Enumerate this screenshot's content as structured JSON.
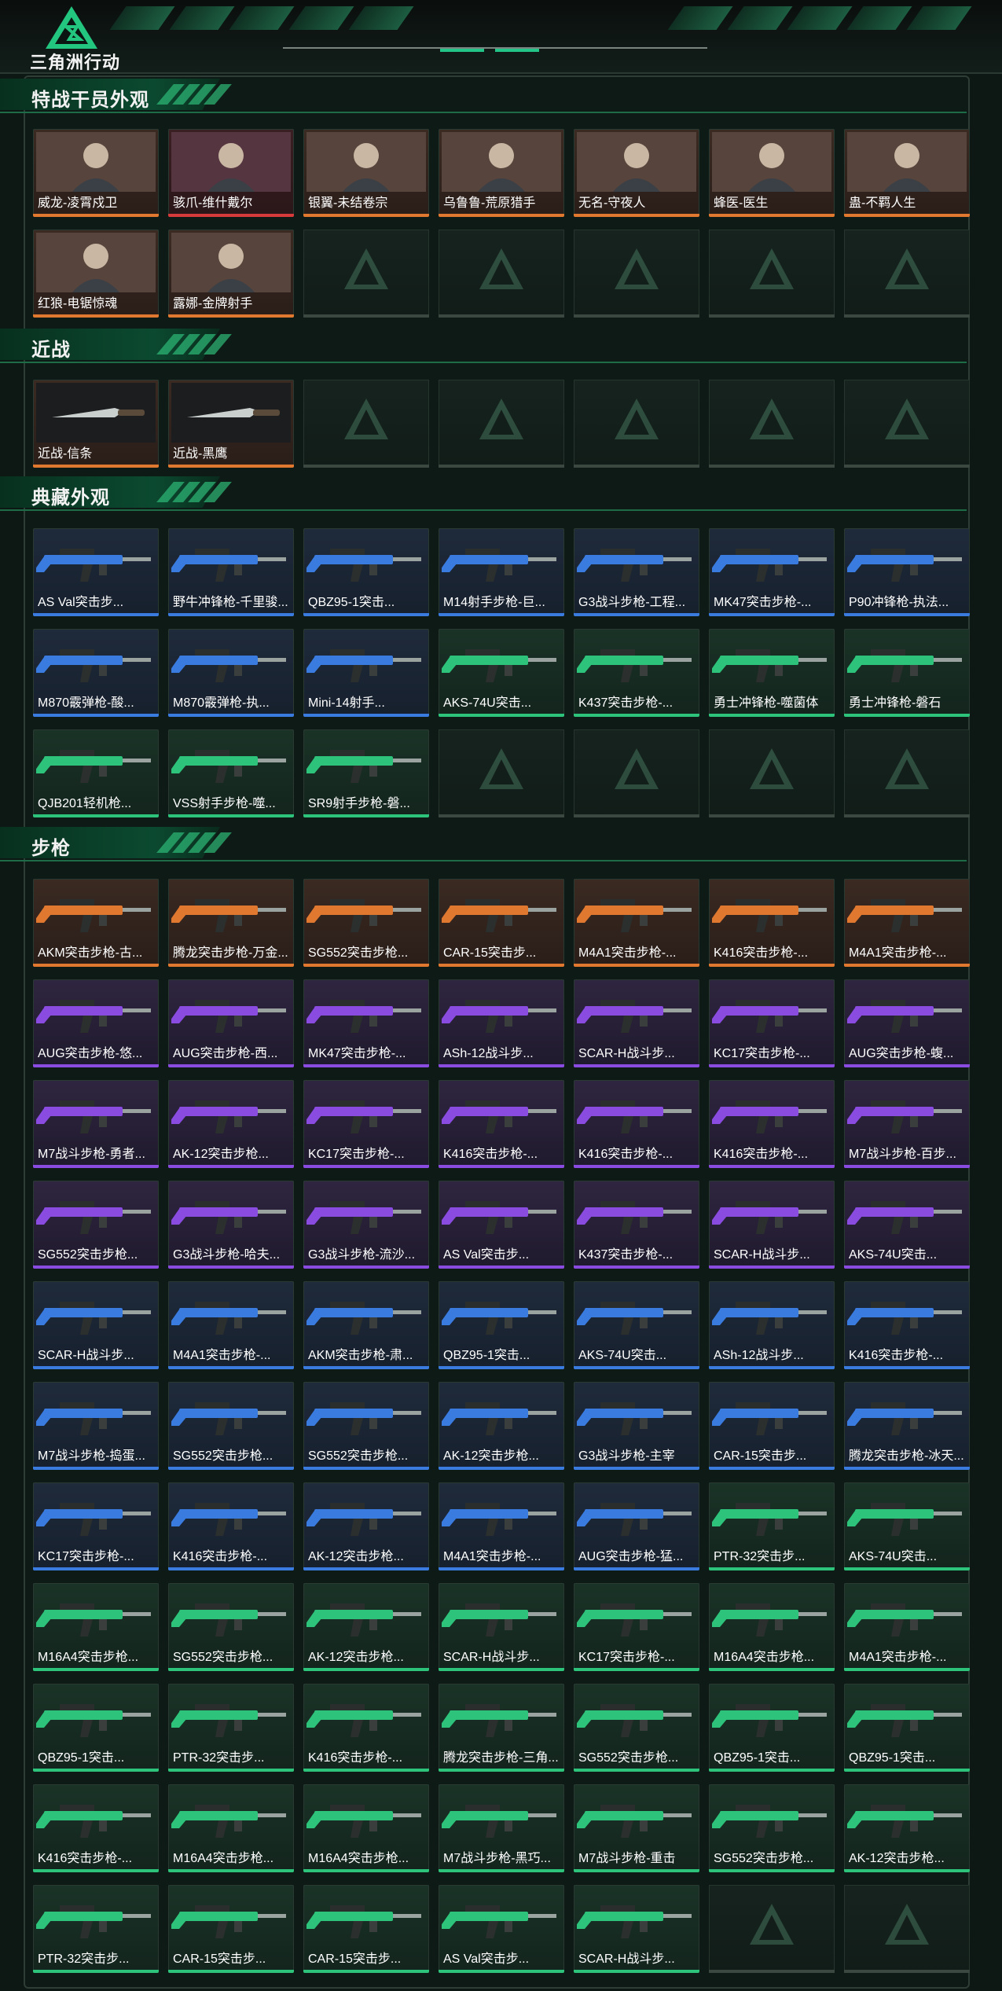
{
  "app_title": "三角洲行动",
  "sections": [
    {
      "id": "operators",
      "title": "特战干员外观",
      "empty_slots": 5,
      "items": [
        {
          "label": "威龙-凌霄戍卫",
          "rarity": "orange",
          "icon": "operator-portrait"
        },
        {
          "label": "骇爪-维什戴尔",
          "rarity": "red",
          "icon": "operator-portrait"
        },
        {
          "label": "银翼-未结卷宗",
          "rarity": "orange",
          "icon": "operator-portrait"
        },
        {
          "label": "乌鲁鲁-荒原猎手",
          "rarity": "orange",
          "icon": "operator-portrait"
        },
        {
          "label": "无名-守夜人",
          "rarity": "orange",
          "icon": "operator-portrait"
        },
        {
          "label": "蜂医-医生",
          "rarity": "orange",
          "icon": "operator-portrait"
        },
        {
          "label": "蛊-不羁人生",
          "rarity": "orange",
          "icon": "operator-portrait"
        },
        {
          "label": "红狼-电锯惊魂",
          "rarity": "orange",
          "icon": "operator-portrait"
        },
        {
          "label": "露娜-金牌射手",
          "rarity": "orange",
          "icon": "operator-portrait"
        }
      ]
    },
    {
      "id": "melee",
      "title": "近战",
      "empty_slots": 5,
      "items": [
        {
          "label": "近战-信条",
          "rarity": "orange",
          "icon": "knife"
        },
        {
          "label": "近战-黑鹰",
          "rarity": "orange",
          "icon": "knife"
        }
      ]
    },
    {
      "id": "collection",
      "title": "典藏外观",
      "empty_slots": 4,
      "items": [
        {
          "label": "AS Val突击步...",
          "rarity": "blue",
          "icon": "rifle"
        },
        {
          "label": "野牛冲锋枪-千里骏...",
          "rarity": "blue",
          "icon": "rifle"
        },
        {
          "label": "QBZ95-1突击...",
          "rarity": "blue",
          "icon": "rifle"
        },
        {
          "label": "M14射手步枪-巨...",
          "rarity": "blue",
          "icon": "rifle"
        },
        {
          "label": "G3战斗步枪-工程...",
          "rarity": "blue",
          "icon": "rifle"
        },
        {
          "label": "MK47突击步枪-...",
          "rarity": "blue",
          "icon": "rifle"
        },
        {
          "label": "P90冲锋枪-执法...",
          "rarity": "blue",
          "icon": "rifle"
        },
        {
          "label": "M870霰弹枪-酸...",
          "rarity": "blue",
          "icon": "rifle"
        },
        {
          "label": "M870霰弹枪-执...",
          "rarity": "blue",
          "icon": "rifle"
        },
        {
          "label": "Mini-14射手...",
          "rarity": "blue",
          "icon": "rifle"
        },
        {
          "label": "AKS-74U突击...",
          "rarity": "green",
          "icon": "rifle"
        },
        {
          "label": "K437突击步枪-...",
          "rarity": "green",
          "icon": "rifle"
        },
        {
          "label": "勇士冲锋枪-噬菌体",
          "rarity": "green",
          "icon": "rifle"
        },
        {
          "label": "勇士冲锋枪-磐石",
          "rarity": "green",
          "icon": "rifle"
        },
        {
          "label": "QJB201轻机枪...",
          "rarity": "green",
          "icon": "rifle"
        },
        {
          "label": "VSS射手步枪-噬...",
          "rarity": "green",
          "icon": "rifle"
        },
        {
          "label": "SR9射手步枪-磐...",
          "rarity": "green",
          "icon": "rifle"
        }
      ]
    },
    {
      "id": "rifles",
      "title": "步枪",
      "empty_slots": 2,
      "items": [
        {
          "label": "AKM突击步枪-古...",
          "rarity": "orange",
          "icon": "rifle"
        },
        {
          "label": "腾龙突击步枪-万金...",
          "rarity": "orange",
          "icon": "rifle"
        },
        {
          "label": "SG552突击步枪...",
          "rarity": "orange",
          "icon": "rifle"
        },
        {
          "label": "CAR-15突击步...",
          "rarity": "orange",
          "icon": "rifle"
        },
        {
          "label": "M4A1突击步枪-...",
          "rarity": "orange",
          "icon": "rifle"
        },
        {
          "label": "K416突击步枪-...",
          "rarity": "orange",
          "icon": "rifle"
        },
        {
          "label": "M4A1突击步枪-...",
          "rarity": "orange",
          "icon": "rifle"
        },
        {
          "label": "AUG突击步枪-悠...",
          "rarity": "purple",
          "icon": "rifle"
        },
        {
          "label": "AUG突击步枪-西...",
          "rarity": "purple",
          "icon": "rifle"
        },
        {
          "label": "MK47突击步枪-...",
          "rarity": "purple",
          "icon": "rifle"
        },
        {
          "label": "ASh-12战斗步...",
          "rarity": "purple",
          "icon": "rifle"
        },
        {
          "label": "SCAR-H战斗步...",
          "rarity": "purple",
          "icon": "rifle"
        },
        {
          "label": "KC17突击步枪-...",
          "rarity": "purple",
          "icon": "rifle"
        },
        {
          "label": "AUG突击步枪-蝮...",
          "rarity": "purple",
          "icon": "rifle"
        },
        {
          "label": "M7战斗步枪-勇者...",
          "rarity": "purple",
          "icon": "rifle"
        },
        {
          "label": "AK-12突击步枪...",
          "rarity": "purple",
          "icon": "rifle"
        },
        {
          "label": "KC17突击步枪-...",
          "rarity": "purple",
          "icon": "rifle"
        },
        {
          "label": "K416突击步枪-...",
          "rarity": "purple",
          "icon": "rifle"
        },
        {
          "label": "K416突击步枪-...",
          "rarity": "purple",
          "icon": "rifle"
        },
        {
          "label": "K416突击步枪-...",
          "rarity": "purple",
          "icon": "rifle"
        },
        {
          "label": "M7战斗步枪-百步...",
          "rarity": "purple",
          "icon": "rifle"
        },
        {
          "label": "SG552突击步枪...",
          "rarity": "purple",
          "icon": "rifle"
        },
        {
          "label": "G3战斗步枪-哈夫...",
          "rarity": "purple",
          "icon": "rifle"
        },
        {
          "label": "G3战斗步枪-流沙...",
          "rarity": "purple",
          "icon": "rifle"
        },
        {
          "label": "AS Val突击步...",
          "rarity": "purple",
          "icon": "rifle"
        },
        {
          "label": "K437突击步枪-...",
          "rarity": "purple",
          "icon": "rifle"
        },
        {
          "label": "SCAR-H战斗步...",
          "rarity": "purple",
          "icon": "rifle"
        },
        {
          "label": "AKS-74U突击...",
          "rarity": "purple",
          "icon": "rifle"
        },
        {
          "label": "SCAR-H战斗步...",
          "rarity": "blue",
          "icon": "rifle"
        },
        {
          "label": "M4A1突击步枪-...",
          "rarity": "blue",
          "icon": "rifle"
        },
        {
          "label": "AKM突击步枪-肃...",
          "rarity": "blue",
          "icon": "rifle"
        },
        {
          "label": "QBZ95-1突击...",
          "rarity": "blue",
          "icon": "rifle"
        },
        {
          "label": "AKS-74U突击...",
          "rarity": "blue",
          "icon": "rifle"
        },
        {
          "label": "ASh-12战斗步...",
          "rarity": "blue",
          "icon": "rifle"
        },
        {
          "label": "K416突击步枪-...",
          "rarity": "blue",
          "icon": "rifle"
        },
        {
          "label": "M7战斗步枪-捣蛋...",
          "rarity": "blue",
          "icon": "rifle"
        },
        {
          "label": "SG552突击步枪...",
          "rarity": "blue",
          "icon": "rifle"
        },
        {
          "label": "SG552突击步枪...",
          "rarity": "blue",
          "icon": "rifle"
        },
        {
          "label": "AK-12突击步枪...",
          "rarity": "blue",
          "icon": "rifle"
        },
        {
          "label": "G3战斗步枪-主宰",
          "rarity": "blue",
          "icon": "rifle"
        },
        {
          "label": "CAR-15突击步...",
          "rarity": "blue",
          "icon": "rifle"
        },
        {
          "label": "腾龙突击步枪-冰天...",
          "rarity": "blue",
          "icon": "rifle"
        },
        {
          "label": "KC17突击步枪-...",
          "rarity": "blue",
          "icon": "rifle"
        },
        {
          "label": "K416突击步枪-...",
          "rarity": "blue",
          "icon": "rifle"
        },
        {
          "label": "AK-12突击步枪...",
          "rarity": "blue",
          "icon": "rifle"
        },
        {
          "label": "M4A1突击步枪-...",
          "rarity": "blue",
          "icon": "rifle"
        },
        {
          "label": "AUG突击步枪-猛...",
          "rarity": "blue",
          "icon": "rifle"
        },
        {
          "label": "PTR-32突击步...",
          "rarity": "green",
          "icon": "rifle"
        },
        {
          "label": "AKS-74U突击...",
          "rarity": "green",
          "icon": "rifle"
        },
        {
          "label": "M16A4突击步枪...",
          "rarity": "green",
          "icon": "rifle"
        },
        {
          "label": "SG552突击步枪...",
          "rarity": "green",
          "icon": "rifle"
        },
        {
          "label": "AK-12突击步枪...",
          "rarity": "green",
          "icon": "rifle"
        },
        {
          "label": "SCAR-H战斗步...",
          "rarity": "green",
          "icon": "rifle"
        },
        {
          "label": "KC17突击步枪-...",
          "rarity": "green",
          "icon": "rifle"
        },
        {
          "label": "M16A4突击步枪...",
          "rarity": "green",
          "icon": "rifle"
        },
        {
          "label": "M4A1突击步枪-...",
          "rarity": "green",
          "icon": "rifle"
        },
        {
          "label": "QBZ95-1突击...",
          "rarity": "green",
          "icon": "rifle"
        },
        {
          "label": "PTR-32突击步...",
          "rarity": "green",
          "icon": "rifle"
        },
        {
          "label": "K416突击步枪-...",
          "rarity": "green",
          "icon": "rifle"
        },
        {
          "label": "腾龙突击步枪-三角...",
          "rarity": "green",
          "icon": "rifle"
        },
        {
          "label": "SG552突击步枪...",
          "rarity": "green",
          "icon": "rifle"
        },
        {
          "label": "QBZ95-1突击...",
          "rarity": "green",
          "icon": "rifle"
        },
        {
          "label": "QBZ95-1突击...",
          "rarity": "green",
          "icon": "rifle"
        },
        {
          "label": "K416突击步枪-...",
          "rarity": "green",
          "icon": "rifle"
        },
        {
          "label": "M16A4突击步枪...",
          "rarity": "green",
          "icon": "rifle"
        },
        {
          "label": "M16A4突击步枪...",
          "rarity": "green",
          "icon": "rifle"
        },
        {
          "label": "M7战斗步枪-黑巧...",
          "rarity": "green",
          "icon": "rifle"
        },
        {
          "label": "M7战斗步枪-重击",
          "rarity": "green",
          "icon": "rifle"
        },
        {
          "label": "SG552突击步枪...",
          "rarity": "green",
          "icon": "rifle"
        },
        {
          "label": "AK-12突击步枪...",
          "rarity": "green",
          "icon": "rifle"
        },
        {
          "label": "PTR-32突击步...",
          "rarity": "green",
          "icon": "rifle"
        },
        {
          "label": "CAR-15突击步...",
          "rarity": "green",
          "icon": "rifle"
        },
        {
          "label": "CAR-15突击步...",
          "rarity": "green",
          "icon": "rifle"
        },
        {
          "label": "AS Val突击步...",
          "rarity": "green",
          "icon": "rifle"
        },
        {
          "label": "SCAR-H战斗步...",
          "rarity": "green",
          "icon": "rifle"
        }
      ]
    }
  ],
  "colors": {
    "accent": "#2ec37a",
    "orange": "#e0782f",
    "red": "#d63a3a",
    "purple": "#8a4be0",
    "blue": "#3a7be0",
    "green": "#2ec37a"
  }
}
